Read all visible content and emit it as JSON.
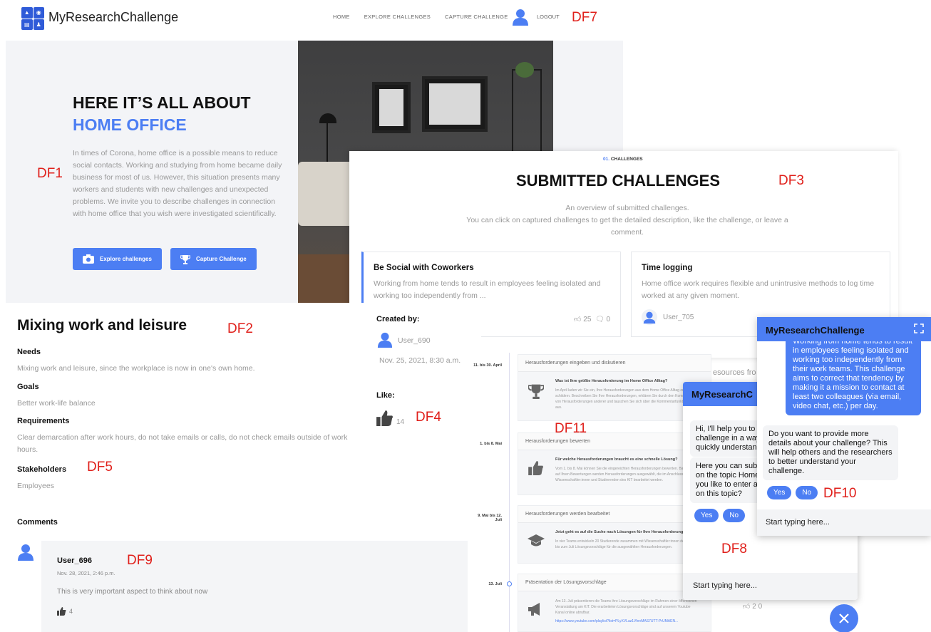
{
  "nav": {
    "brand": "MyResearchChallenge",
    "links": [
      "HOME",
      "EXPLORE CHALLENGES",
      "CAPTURE CHALLENGE"
    ],
    "logout": "LOGOUT"
  },
  "annotations": {
    "df1": "DF1",
    "df2": "DF2",
    "df3": "DF3",
    "df4": "DF4",
    "df5": "DF5",
    "df7": "DF7",
    "df8": "DF8",
    "df9": "DF9",
    "df10": "DF10",
    "df11": "DF11"
  },
  "hero": {
    "title_line1": "HERE IT’S ALL ABOUT",
    "title_line2": "HOME OFFICE",
    "text": "In times of Corona, home office is a possible means to reduce social contacts. Working and studying from home became daily business for most of us. However, this situation presents many workers and students with new challenges and unexpected problems. We invite you to describe challenges in connection with home office that you wish were investigated scientifically.",
    "btn_explore": "Explore challenges",
    "btn_capture": "Capture Challenge"
  },
  "submitted": {
    "kicker_num": "01.",
    "kicker_label": "CHALLENGES",
    "title": "SUBMITTED CHALLENGES",
    "desc1": "An overview of submitted challenges.",
    "desc2": "You can click on captured challenges to get the detailed description, like the challenge, or leave a comment.",
    "cards": [
      {
        "title": "Be Social with Coworkers",
        "text": "Working from home tends to result in employees feeling isolated and working too independently from ...",
        "likes": "25",
        "comments": "0"
      },
      {
        "title": "Time logging",
        "text": "Home office work requires flexible and unintrusive methods to log time worked at any given moment.",
        "user": "User_705"
      }
    ]
  },
  "detail": {
    "title": "Mixing work and leisure",
    "needs_label": "Needs",
    "needs": "Mixing work and leisure, since the workplace is now in one's own home.",
    "goals_label": "Goals",
    "goals": "Better work-life balance",
    "req_label": "Requirements",
    "req": "Clear demarcation after work hours, do not take emails or calls, do not check emails outside of work hours.",
    "stake_label": "Stakeholders",
    "stake": "Employees",
    "comments_label": "Comments"
  },
  "created": {
    "label": "Created by:",
    "user": "User_690",
    "date": "Nov. 25, 2021, 8:30 a.m.",
    "like_label": "Like:",
    "likes": "14"
  },
  "comment": {
    "user": "User_696",
    "time": "Nov. 28, 2021, 2:46 p.m.",
    "text": "This is very important aspect to think about now",
    "likes": "4"
  },
  "timeline": {
    "items": [
      {
        "date": "11. bis 30. April",
        "head": "Herausforderungen eingeben und diskutieren",
        "q": "Was ist Ihre größte Herausforderung im Home Office Alltag?",
        "t": "Im April laden wir Sie ein, Ihre Herausforderungen aus dem Home Office Alltag zu schildern. Beschreiben Sie Ihre Herausforderungen, erklären Sie durch den Kommentar von Herausforderungen anderer und tauschen Sie sich über die Kommentarfunktion dazu aus."
      },
      {
        "date": "1. bis 8. Mai",
        "head": "Herausforderungen bewerten",
        "q": "Für welche Herausforderungen braucht es eine schnelle Lösung?",
        "t": "Vom 1. bis 8. Mai können Sie die eingereichten Herausforderungen bewerten. Basierend auf Ihren Bewertungen werden Herausforderungen ausgewählt, die im Anschluss von Wissenschaftler:innen und Studierenden des KIT bearbeitet werden."
      },
      {
        "date": "9. Mai bis 12. Juli",
        "head": "Herausforderungen werden bearbeitet",
        "q": "Jetzt geht es auf die Suche nach Lösungen für Ihre Herausforderungen",
        "t": "In vier Teams entwickeln 20 Studierende zusammen mit Wissenschaftler:innen des KIT bis zum Juli Lösungsvorschläge für die ausgewählten Herausforderungen."
      },
      {
        "date": "13. Juli",
        "head": "Präsentation der Lösungsvorschläge",
        "q": "",
        "t": "Am 13. Juli präsentieren die Teams ihre Lösungsvorschläge im Rahmen einer öffentlichen Veranstaltung am KIT. Die erarbeiteten Lösungsvorschläge sind auf unserem Youtube Kanal online abrufbar."
      },
      {
        "date": "",
        "head": "",
        "q": "",
        "t": "https://www.youtube.com/playlist?list=PLyXVLaz1VhrvMAS7UTT-PrUMAEN..."
      }
    ],
    "overlap_text": "esources fro",
    "footer_stats": "2   0"
  },
  "chat1": {
    "title": "MyResearchC",
    "msg1": "Hi, I'll help you to capture a challenge in a way that others quickly understand it.",
    "msg2": "Here you can submit challenges on the topic Home Office. Would you like to enter a new challenge on this topic?",
    "yes": "Yes",
    "no": "No",
    "input_placeholder": "Start typing here..."
  },
  "chat2": {
    "title": "MyResearchChallenge",
    "blue_msg": "Working from home tends to result in employees feeling isolated and working too independently from their work teams. This challenge aims to correct that tendency by making it a mission to contact at least two colleagues (via email, video chat, etc.) per day.",
    "grey_msg": "Do you want to provide more details about your challenge? This will help others and the researchers to better understand your challenge.",
    "yes": "Yes",
    "no": "No",
    "input_placeholder": "Start typing here..."
  },
  "icons": {
    "nav_avatar": "user-avatar-icon",
    "explore": "camera-icon",
    "capture": "trophy-icon",
    "like": "thumbs-up-icon",
    "comment": "comment-bubble-icon",
    "close": "close-icon",
    "expand": "expand-icon"
  },
  "colors": {
    "accent": "#4c7ef3",
    "annotation": "#e0201b"
  }
}
